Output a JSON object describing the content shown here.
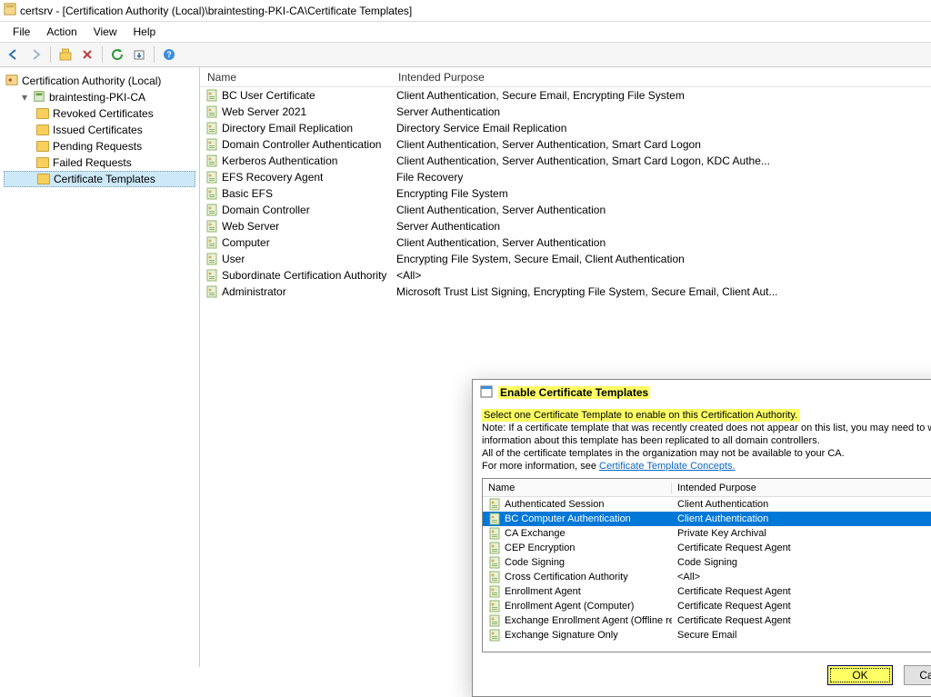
{
  "window": {
    "title": "certsrv - [Certification Authority (Local)\\braintesting-PKI-CA\\Certificate Templates]"
  },
  "menu": {
    "file": "File",
    "action": "Action",
    "view": "View",
    "help": "Help"
  },
  "tree": {
    "root": "Certification Authority (Local)",
    "ca": "braintesting-PKI-CA",
    "items": [
      "Revoked Certificates",
      "Issued Certificates",
      "Pending Requests",
      "Failed Requests",
      "Certificate Templates"
    ]
  },
  "list": {
    "header_name": "Name",
    "header_purpose": "Intended Purpose",
    "rows": [
      {
        "name": "BC User Certificate",
        "purpose": "Client Authentication, Secure Email, Encrypting File System"
      },
      {
        "name": "Web Server 2021",
        "purpose": "Server Authentication"
      },
      {
        "name": "Directory Email Replication",
        "purpose": "Directory Service Email Replication"
      },
      {
        "name": "Domain Controller Authentication",
        "purpose": "Client Authentication, Server Authentication, Smart Card Logon"
      },
      {
        "name": "Kerberos Authentication",
        "purpose": "Client Authentication, Server Authentication, Smart Card Logon, KDC Authe..."
      },
      {
        "name": "EFS Recovery Agent",
        "purpose": "File Recovery"
      },
      {
        "name": "Basic EFS",
        "purpose": "Encrypting File System"
      },
      {
        "name": "Domain Controller",
        "purpose": "Client Authentication, Server Authentication"
      },
      {
        "name": "Web Server",
        "purpose": "Server Authentication"
      },
      {
        "name": "Computer",
        "purpose": "Client Authentication, Server Authentication"
      },
      {
        "name": "User",
        "purpose": "Encrypting File System, Secure Email, Client Authentication"
      },
      {
        "name": "Subordinate Certification Authority",
        "purpose": "<All>"
      },
      {
        "name": "Administrator",
        "purpose": "Microsoft Trust List Signing, Encrypting File System, Secure Email, Client Aut..."
      }
    ]
  },
  "dialog": {
    "title": "Enable Certificate Templates",
    "instruction": "Select one Certificate Template to enable on this Certification Authority.",
    "note1": "Note: If a certificate template that was recently created does not appear on this list, you may need to wait until information about this template has been replicated to all domain controllers.",
    "note2": "All of the certificate templates in the organization may not be available to your CA.",
    "link_prefix": "For more information, see ",
    "link_text": "Certificate Template Concepts.",
    "header_name": "Name",
    "header_purpose": "Intended Purpose",
    "rows": [
      {
        "name": "Authenticated Session",
        "purpose": "Client Authentication"
      },
      {
        "name": "BC Computer Authentication",
        "purpose": "Client Authentication",
        "selected": true
      },
      {
        "name": "CA Exchange",
        "purpose": "Private Key Archival"
      },
      {
        "name": "CEP Encryption",
        "purpose": "Certificate Request Agent"
      },
      {
        "name": "Code Signing",
        "purpose": "Code Signing"
      },
      {
        "name": "Cross Certification Authority",
        "purpose": "<All>"
      },
      {
        "name": "Enrollment Agent",
        "purpose": "Certificate Request Agent"
      },
      {
        "name": "Enrollment Agent (Computer)",
        "purpose": "Certificate Request Agent"
      },
      {
        "name": "Exchange Enrollment Agent (Offline request)",
        "purpose": "Certificate Request Agent"
      },
      {
        "name": "Exchange Signature Only",
        "purpose": "Secure Email"
      }
    ],
    "ok": "OK",
    "cancel": "Cancel"
  }
}
